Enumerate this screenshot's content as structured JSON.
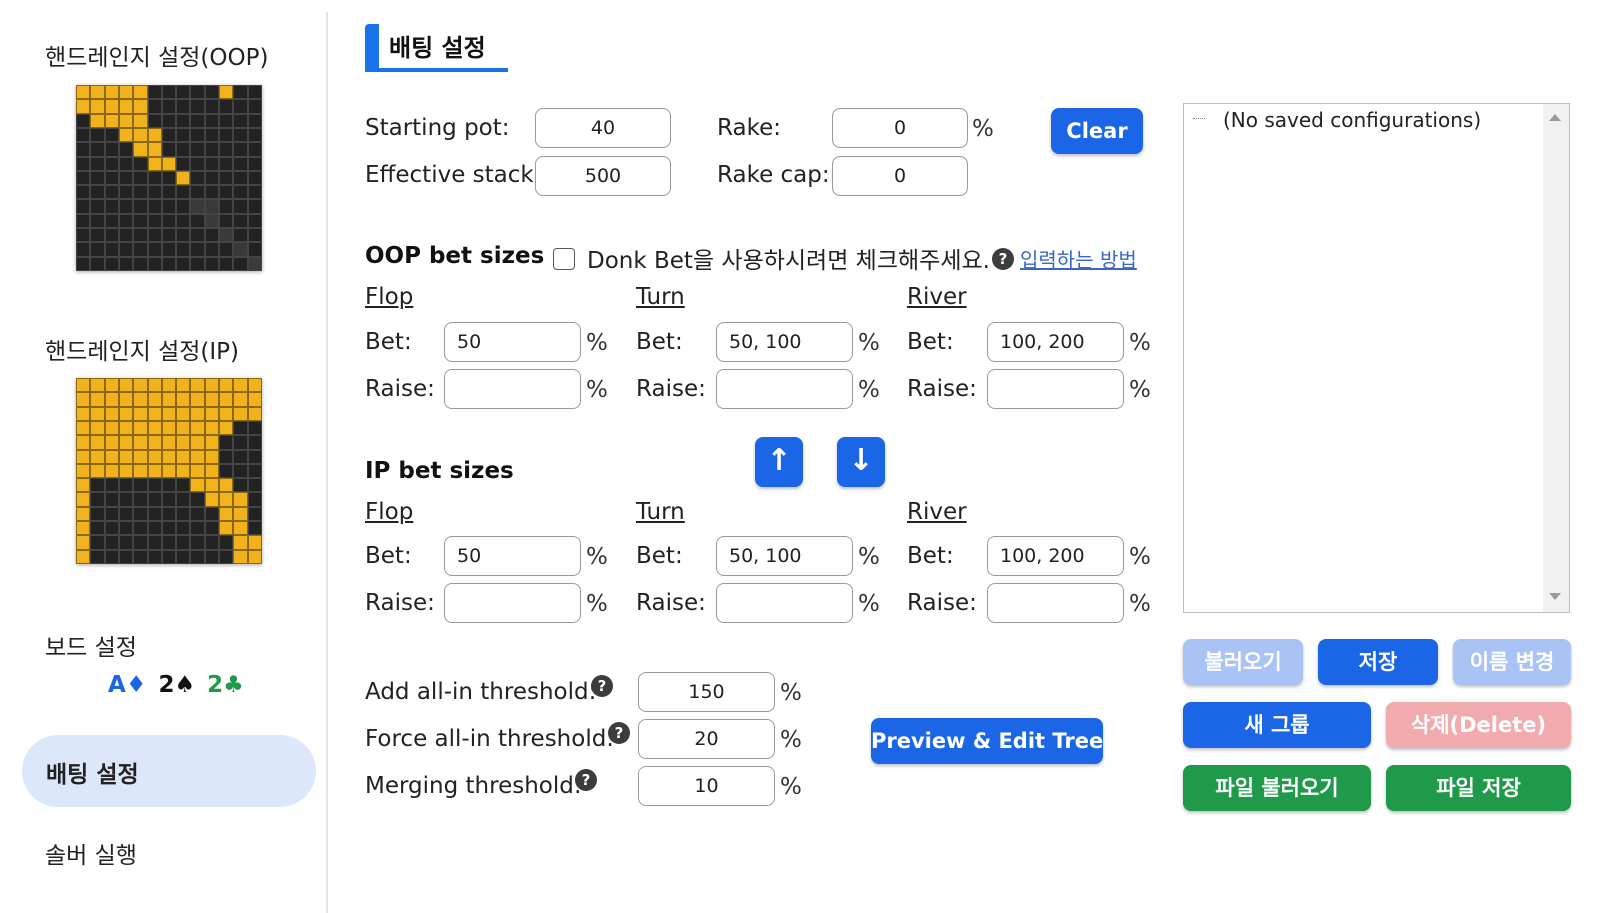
{
  "sidebar": {
    "oop_label": "핸드레인지 설정(OOP)",
    "ip_label": "핸드레인지 설정(IP)",
    "board_label": "보드 설정",
    "board_cards": [
      {
        "rank": "A",
        "suit": "♦",
        "color": "#1a66e6"
      },
      {
        "rank": "2",
        "suit": "♠",
        "color": "#111111"
      },
      {
        "rank": "2",
        "suit": "♣",
        "color": "#1e9a4a"
      }
    ],
    "nav_betting": "배팅 설정",
    "nav_solver": "솔버 실행"
  },
  "header": {
    "tab_title": "배팅 설정"
  },
  "config": {
    "starting_pot_label": "Starting pot:",
    "starting_pot": "40",
    "effective_stack_label": "Effective stack:",
    "effective_stack": "500",
    "rake_label": "Rake:",
    "rake": "0",
    "rake_pct": "%",
    "rake_cap_label": "Rake cap:",
    "rake_cap": "0",
    "clear_button": "Clear"
  },
  "oop": {
    "title": "OOP bet sizes",
    "donk_label": "Donk Bet을 사용하시려면 체크해주세요.",
    "howto_link": "입력하는 방법",
    "flop": {
      "heading": "Flop",
      "bet_label": "Bet:",
      "bet": "50",
      "raise_label": "Raise:",
      "raise": "",
      "pct": "%"
    },
    "turn": {
      "heading": "Turn",
      "bet_label": "Bet:",
      "bet": "50, 100",
      "raise_label": "Raise:",
      "raise": "",
      "pct": "%"
    },
    "river": {
      "heading": "River",
      "bet_label": "Bet:",
      "bet": "100, 200",
      "raise_label": "Raise:",
      "raise": "",
      "pct": "%"
    }
  },
  "ip": {
    "title": "IP bet sizes",
    "flop": {
      "heading": "Flop",
      "bet_label": "Bet:",
      "bet": "50",
      "raise_label": "Raise:",
      "raise": "",
      "pct": "%"
    },
    "turn": {
      "heading": "Turn",
      "bet_label": "Bet:",
      "bet": "50, 100",
      "raise_label": "Raise:",
      "raise": "",
      "pct": "%"
    },
    "river": {
      "heading": "River",
      "bet_label": "Bet:",
      "bet": "100, 200",
      "raise_label": "Raise:",
      "raise": "",
      "pct": "%"
    }
  },
  "arrows": {
    "up": "↑",
    "down": "↓"
  },
  "thresholds": {
    "allin_label": "Add all-in threshold:",
    "allin": "150",
    "force_label": "Force all-in threshold:",
    "force": "20",
    "merge_label": "Merging threshold:",
    "merge": "10",
    "pct": "%",
    "help": "?"
  },
  "preview_button": "Preview & Edit Tree",
  "saved": {
    "empty_text": "(No saved configurations)",
    "load": "불러오기",
    "save": "저장",
    "rename": "이름 변경",
    "new_group": "새 그룹",
    "delete": "삭제(Delete)",
    "file_load": "파일 불러오기",
    "file_save": "파일 저장"
  },
  "ranges": {
    "oop_rows": [
      "1111100000100",
      "1111100000000",
      "0111100000000",
      "0001110000000",
      "0000110000000",
      "0000011000000",
      "0000000100000",
      "0000000000000",
      "0000000022000",
      "0000000002000",
      "0000000000200",
      "0000000000020",
      "0000000000002"
    ],
    "ip_rows": [
      "1111111111111",
      "1111111111111",
      "1111111111111",
      "1111111111100",
      "1111111111000",
      "1111111111000",
      "1111111111000",
      "1000000011100",
      "1000000001110",
      "1000000000110",
      "1000000000110",
      "1000000000011",
      "1000000000011"
    ]
  }
}
